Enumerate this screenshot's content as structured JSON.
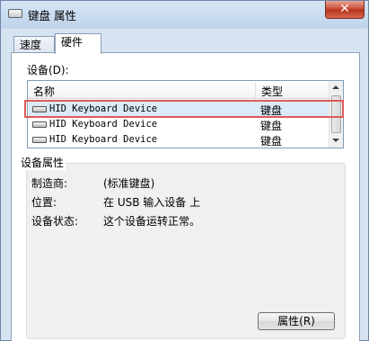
{
  "window": {
    "title": "键盘 属性",
    "close_label": "✕"
  },
  "tabs": [
    {
      "label": "速度",
      "active": false
    },
    {
      "label": "硬件",
      "active": true
    }
  ],
  "devices": {
    "label": "设备(D):",
    "columns": {
      "name": "名称",
      "type": "类型"
    },
    "rows": [
      {
        "name": "HID Keyboard Device",
        "type": "键盘",
        "selected": true
      },
      {
        "name": "HID Keyboard Device",
        "type": "键盘",
        "selected": false
      },
      {
        "name": "HID Keyboard Device",
        "type": "键盘",
        "selected": false
      }
    ]
  },
  "device_properties": {
    "title": "设备属性",
    "manufacturer_label": "制造商:",
    "manufacturer_value": "(标准键盘)",
    "location_label": "位置:",
    "location_value": "在 USB 输入设备 上",
    "status_label": "设备状态:",
    "status_value": "这个设备运转正常。"
  },
  "buttons": {
    "properties": "属性(R)"
  },
  "colors": {
    "highlight": "#e05a5a",
    "close_button": "#c7472f"
  }
}
